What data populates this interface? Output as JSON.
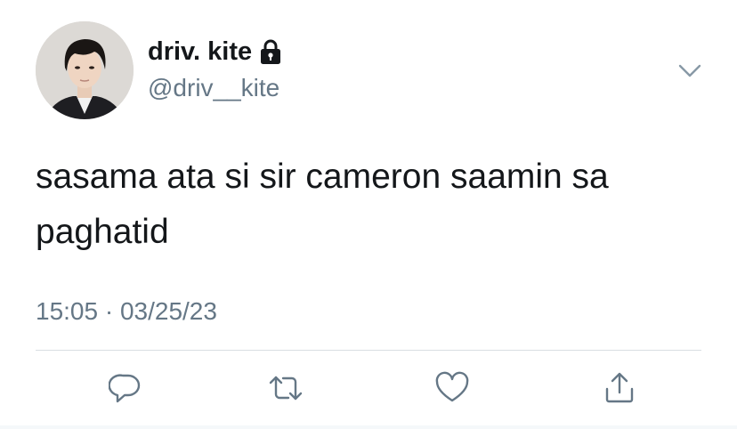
{
  "user": {
    "display_name": "driv. kite",
    "handle": "@driv__kite",
    "protected_icon": "lock-icon",
    "avatar_icon": "profile-photo"
  },
  "tweet": {
    "text": "sasama ata si sir cameron saamin sa paghatid",
    "timestamp": "15:05 · 03/25/23"
  },
  "actions": [
    {
      "icon": "reply-icon"
    },
    {
      "icon": "retweet-icon"
    },
    {
      "icon": "like-icon"
    },
    {
      "icon": "share-icon"
    }
  ],
  "more_icon": "chevron-down-icon",
  "colors": {
    "text": "#14171a",
    "secondary": "#657786",
    "divider": "#d9dee2"
  }
}
